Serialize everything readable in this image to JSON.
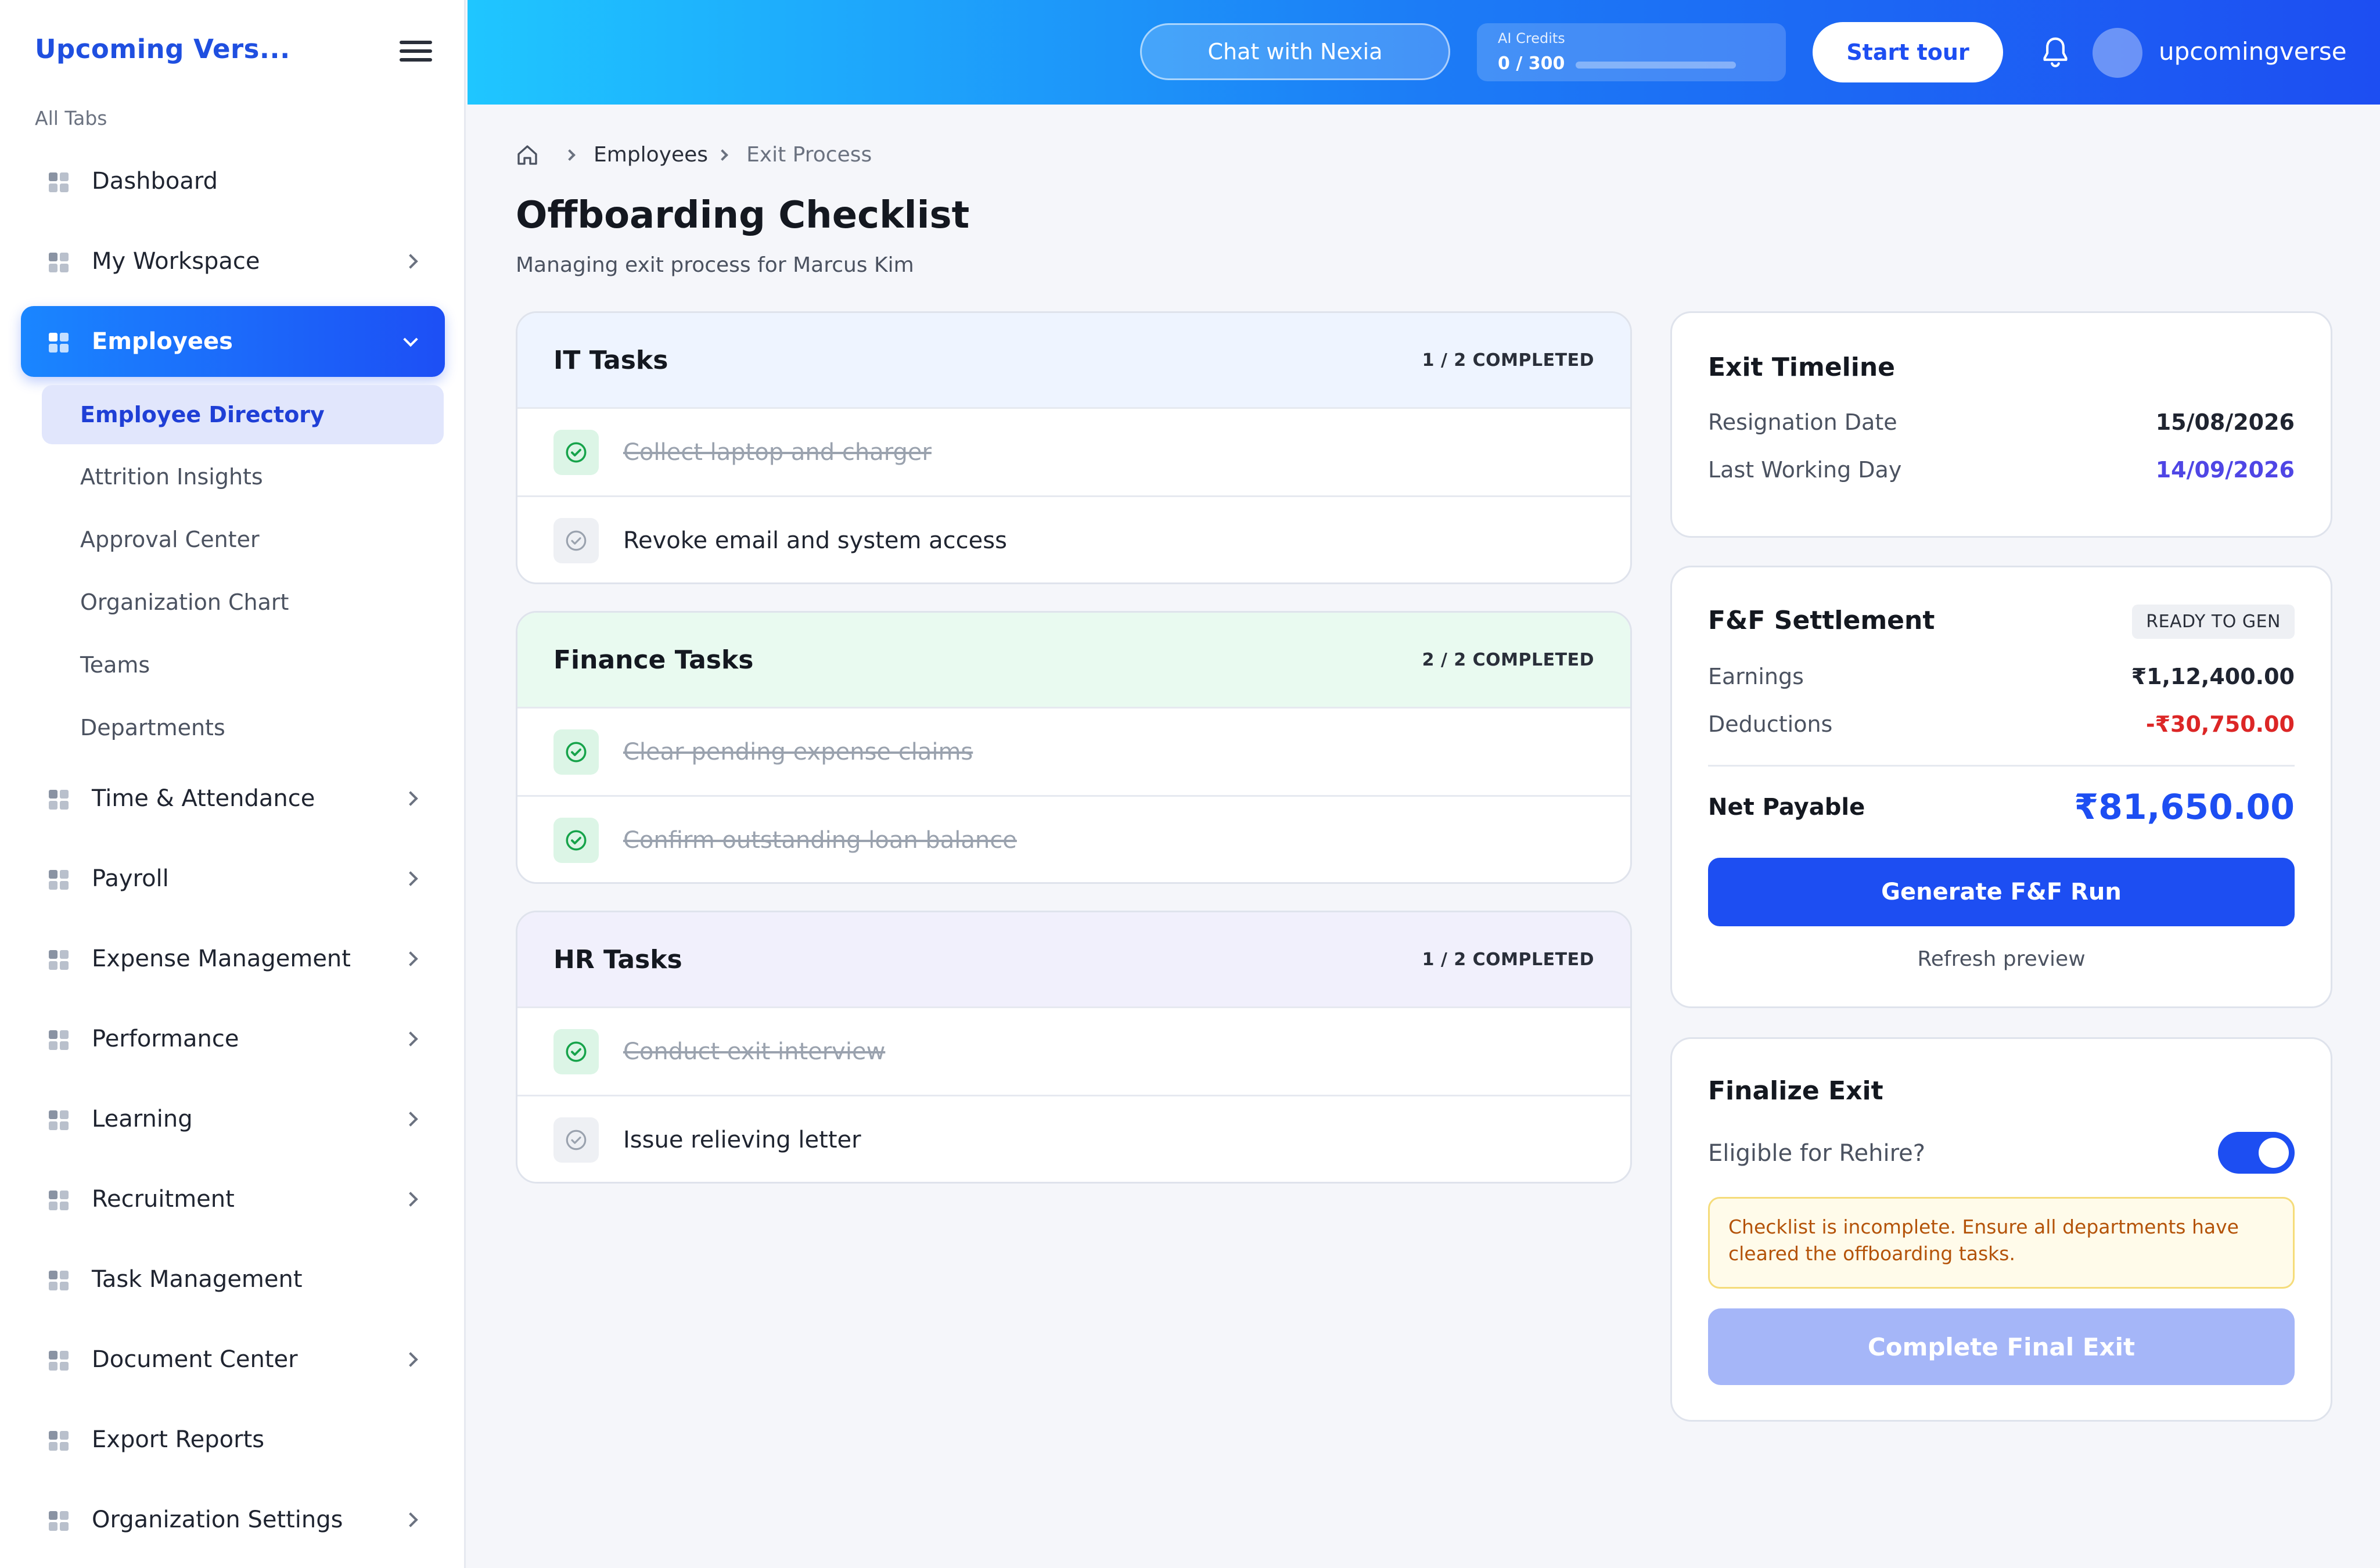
{
  "sidebar": {
    "brand": "Upcoming Vers...",
    "section_label": "All Tabs",
    "items": [
      {
        "label": "Dashboard"
      },
      {
        "label": "My Workspace"
      },
      {
        "label": "Employees"
      },
      {
        "label": "Time & Attendance"
      },
      {
        "label": "Payroll"
      },
      {
        "label": "Expense Management"
      },
      {
        "label": "Performance"
      },
      {
        "label": "Learning"
      },
      {
        "label": "Recruitment"
      },
      {
        "label": "Task Management"
      },
      {
        "label": "Document Center"
      },
      {
        "label": "Export Reports"
      },
      {
        "label": "Organization Settings"
      }
    ],
    "sub_items": [
      {
        "label": "Employee Directory"
      },
      {
        "label": "Attrition Insights"
      },
      {
        "label": "Approval Center"
      },
      {
        "label": "Organization Chart"
      },
      {
        "label": "Teams"
      },
      {
        "label": "Departments"
      }
    ]
  },
  "header": {
    "chat_label": "Chat with Nexia",
    "credits_caption": "AI Credits",
    "credits_value": "0 / 300",
    "credits_fraction": 0,
    "tour_label": "Start tour",
    "username": "upcomingverse"
  },
  "breadcrumb": {
    "level1": "Employees",
    "level2": "Exit Process"
  },
  "page": {
    "title": "Offboarding Checklist",
    "subtitle": "Managing exit process for Marcus Kim"
  },
  "tasks": {
    "it": {
      "title": "IT Tasks",
      "count": "1 / 2 COMPLETED",
      "items": [
        {
          "label": "Collect laptop and charger",
          "done": true
        },
        {
          "label": "Revoke email and system access",
          "done": false
        }
      ]
    },
    "finance": {
      "title": "Finance Tasks",
      "count": "2 / 2 COMPLETED",
      "items": [
        {
          "label": "Clear pending expense claims",
          "done": true
        },
        {
          "label": "Confirm outstanding loan balance",
          "done": true
        }
      ]
    },
    "hr": {
      "title": "HR Tasks",
      "count": "1 / 2 COMPLETED",
      "items": [
        {
          "label": "Conduct exit interview",
          "done": true
        },
        {
          "label": "Issue relieving letter",
          "done": false
        }
      ]
    }
  },
  "timeline": {
    "title": "Exit Timeline",
    "resignation_label": "Resignation Date",
    "resignation_value": "15/08/2026",
    "lwd_label": "Last Working Day",
    "lwd_value": "14/09/2026"
  },
  "settlement": {
    "title": "F&F Settlement",
    "badge": "READY TO GEN",
    "earnings_label": "Earnings",
    "earnings_value": "₹1,12,400.00",
    "deductions_label": "Deductions",
    "deductions_value": "-₹30,750.00",
    "net_label": "Net Payable",
    "net_value": "₹81,650.00",
    "generate_label": "Generate F&F Run",
    "refresh_label": "Refresh preview"
  },
  "finalize": {
    "title": "Finalize Exit",
    "rehire_label": "Eligible for Rehire?",
    "rehire_on": true,
    "warning": "Checklist is incomplete. Ensure all departments have cleared the offboarding tasks.",
    "complete_label": "Complete Final Exit"
  },
  "colors": {
    "accent": "#1d4ef2",
    "success": "#16a34a",
    "danger": "#dc2626",
    "lwd": "#4f46e5",
    "it_header": "#eef4ff",
    "finance_header": "#e9faf0",
    "hr_header": "#f1f0fc"
  }
}
